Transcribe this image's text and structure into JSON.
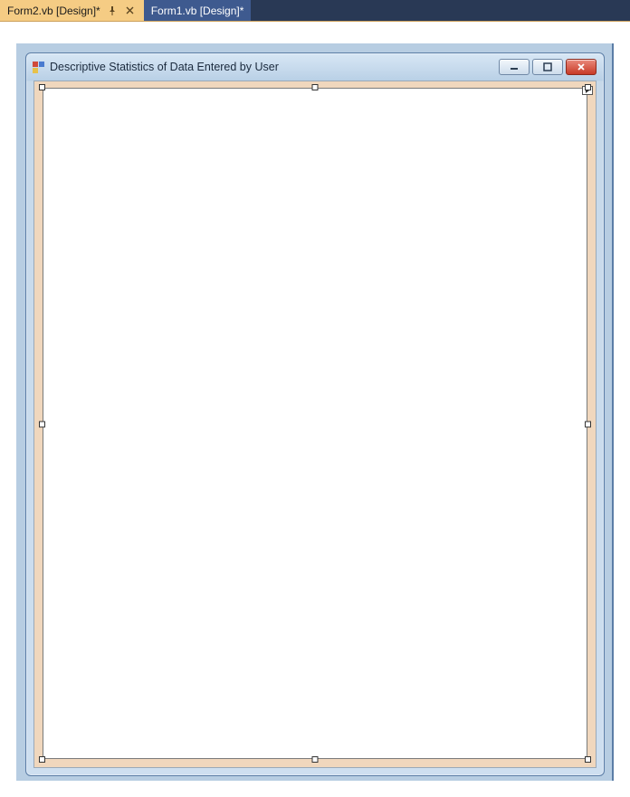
{
  "tabs": {
    "active": {
      "label": "Form2.vb [Design]*"
    },
    "inactive": {
      "label": "Form1.vb [Design]*"
    }
  },
  "form": {
    "title": "Descriptive Statistics of Data Entered by User"
  },
  "icons": {
    "pin": "pin-icon",
    "close_tab": "close-icon",
    "minimize": "minimize-icon",
    "maximize": "maximize-icon",
    "close_window": "close-icon"
  }
}
